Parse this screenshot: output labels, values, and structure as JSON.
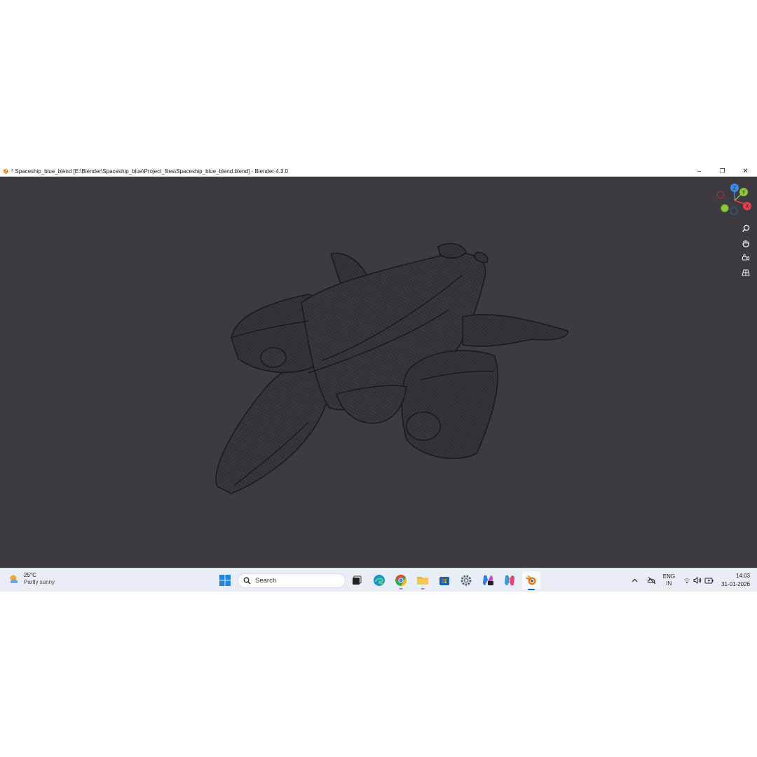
{
  "window": {
    "title": "* Spaceship_blue_blend [E:\\Blender\\Spaceship_blue\\Project_files\\Spaceship_blue_blend.blend] - Blender 4.3.0",
    "minimize_glyph": "–",
    "restore_glyph": "❐",
    "close_glyph": "✕"
  },
  "viewport": {
    "background": "#3d3b3f",
    "gizmo_axes": [
      "Z",
      "Y",
      "X"
    ],
    "tools": [
      "zoom-icon",
      "pan-hand-icon",
      "camera-view-icon",
      "perspective-grid-icon"
    ]
  },
  "taskbar": {
    "weather": {
      "temp": "25°C",
      "condition": "Partly sunny"
    },
    "search_placeholder": "Search",
    "apps": [
      "task-view",
      "edge",
      "chrome",
      "file-explorer",
      "microsoft-store",
      "settings",
      "copilot-news",
      "copilot",
      "blender"
    ],
    "tray": {
      "lang_top": "ENG",
      "lang_bottom": "IN",
      "time": "14:03",
      "date": "31-01-2026"
    }
  },
  "colors": {
    "axis_x": "#e0404e",
    "axis_y": "#8bc43f",
    "axis_z": "#3c8ce7",
    "accent": "#0067c0"
  }
}
